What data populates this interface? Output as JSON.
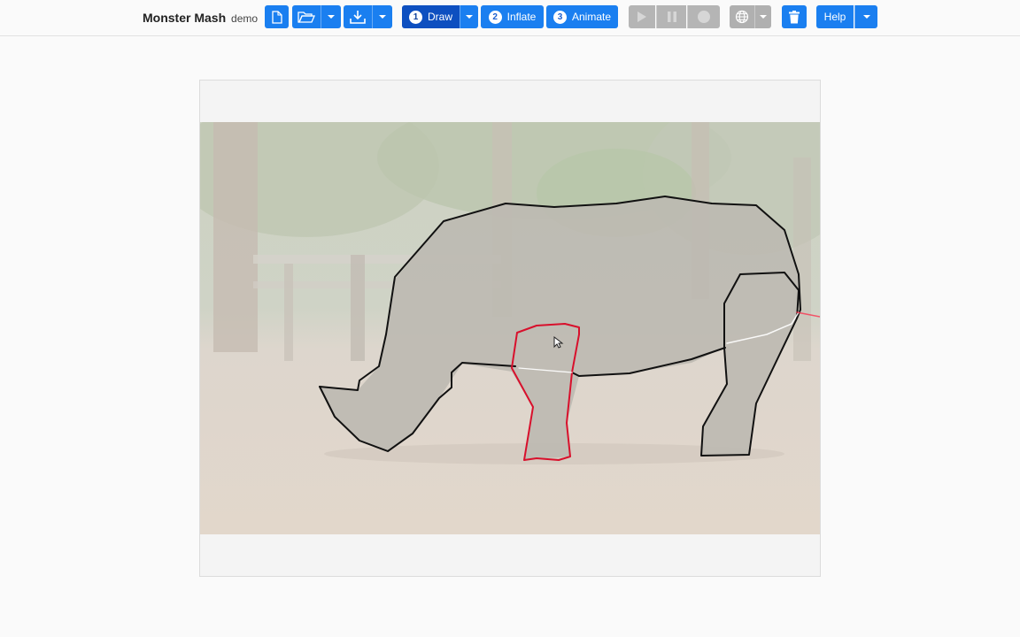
{
  "app": {
    "name": "Monster Mash",
    "subtitle": "demo"
  },
  "toolbar": {
    "new_icon": "file-icon",
    "open_icon": "folder-open-icon",
    "save_icon": "download-icon",
    "draw": {
      "step": "1",
      "label": "Draw"
    },
    "inflate": {
      "step": "2",
      "label": "Inflate"
    },
    "animate": {
      "step": "3",
      "label": "Animate"
    },
    "play_icon": "play-icon",
    "pause_icon": "pause-icon",
    "record_icon": "record-icon",
    "globe_icon": "globe-icon",
    "delete_icon": "trash-icon",
    "help_label": "Help"
  },
  "colors": {
    "accent": "#1a7ff0",
    "active": "#0d4fc0",
    "disabled": "#b5b5b5",
    "outline_black": "#111111",
    "outline_red": "#d8102c"
  }
}
